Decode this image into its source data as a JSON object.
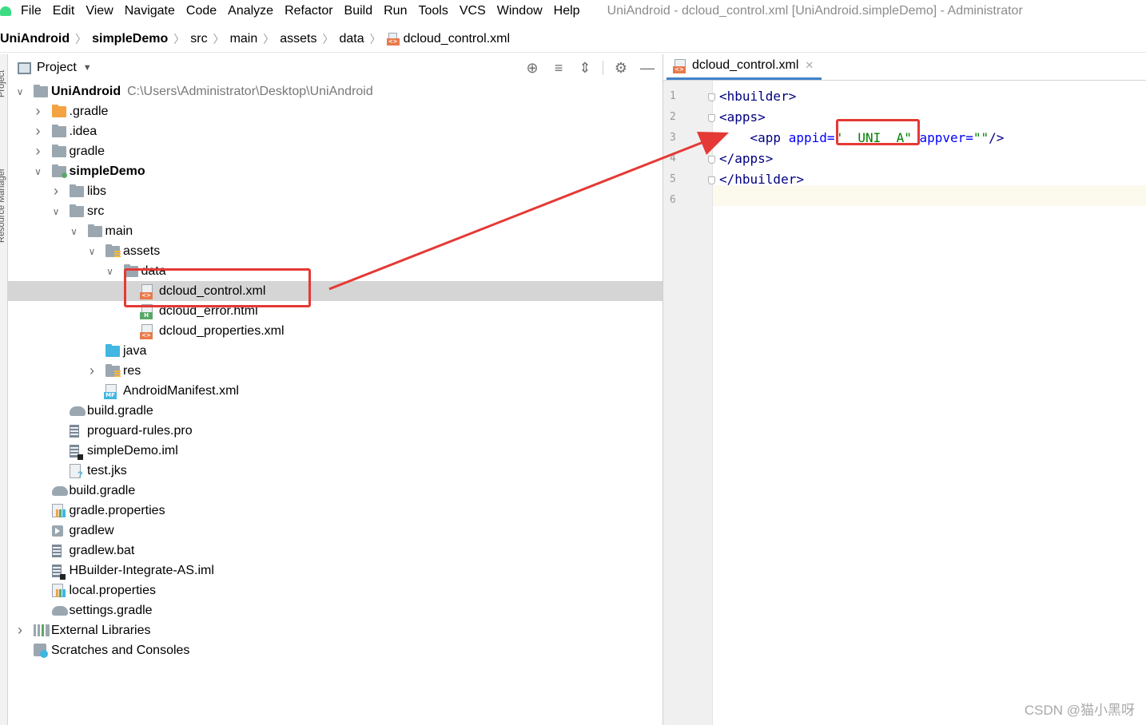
{
  "menu": {
    "items": [
      "File",
      "Edit",
      "View",
      "Navigate",
      "Code",
      "Analyze",
      "Refactor",
      "Build",
      "Run",
      "Tools",
      "VCS",
      "Window",
      "Help"
    ],
    "window_title": "UniAndroid - dcloud_control.xml [UniAndroid.simpleDemo] - Administrator"
  },
  "breadcrumb": {
    "project": "UniAndroid",
    "module": "simpleDemo",
    "parts": [
      "src",
      "main",
      "assets",
      "data"
    ],
    "file": "dcloud_control.xml"
  },
  "tool_strip": {
    "project_label": "Project",
    "resource_label": "Resource Manager"
  },
  "project_panel": {
    "title": "Project",
    "tools": [
      "locate-icon",
      "expand-all-icon",
      "collapse-all-icon",
      "gear-icon",
      "minimize-icon"
    ],
    "root": {
      "name": "UniAndroid",
      "path": "C:\\Users\\Administrator\\Desktop\\UniAndroid"
    },
    "tree": [
      {
        "label": ".gradle",
        "depth": 1,
        "chevron": "right",
        "icon": "folder-orange"
      },
      {
        "label": ".idea",
        "depth": 1,
        "chevron": "right",
        "icon": "folder"
      },
      {
        "label": "gradle",
        "depth": 1,
        "chevron": "right",
        "icon": "folder"
      },
      {
        "label": "simpleDemo",
        "depth": 1,
        "chevron": "down",
        "icon": "module-folder",
        "bold": true
      },
      {
        "label": "libs",
        "depth": 2,
        "chevron": "right",
        "icon": "folder"
      },
      {
        "label": "src",
        "depth": 2,
        "chevron": "down",
        "icon": "folder"
      },
      {
        "label": "main",
        "depth": 3,
        "chevron": "down",
        "icon": "folder"
      },
      {
        "label": "assets",
        "depth": 4,
        "chevron": "down",
        "icon": "resource-folder"
      },
      {
        "label": "data",
        "depth": 5,
        "chevron": "down",
        "icon": "folder"
      },
      {
        "label": "dcloud_control.xml",
        "depth": 6,
        "chevron": "",
        "icon": "xml-file",
        "selected": true
      },
      {
        "label": "dcloud_error.html",
        "depth": 6,
        "chevron": "",
        "icon": "html-file"
      },
      {
        "label": "dcloud_properties.xml",
        "depth": 6,
        "chevron": "",
        "icon": "xml-file"
      },
      {
        "label": "java",
        "depth": 4,
        "chevron": "",
        "icon": "folder-blue"
      },
      {
        "label": "res",
        "depth": 4,
        "chevron": "right",
        "icon": "resource-folder"
      },
      {
        "label": "AndroidManifest.xml",
        "depth": 4,
        "chevron": "",
        "icon": "manifest-file"
      },
      {
        "label": "build.gradle",
        "depth": 2,
        "chevron": "",
        "icon": "gradle-file"
      },
      {
        "label": "proguard-rules.pro",
        "depth": 2,
        "chevron": "",
        "icon": "text-file"
      },
      {
        "label": "simpleDemo.iml",
        "depth": 2,
        "chevron": "",
        "icon": "iml-file"
      },
      {
        "label": "test.jks",
        "depth": 2,
        "chevron": "",
        "icon": "unknown-file"
      },
      {
        "label": "build.gradle",
        "depth": 1,
        "chevron": "",
        "icon": "gradle-file"
      },
      {
        "label": "gradle.properties",
        "depth": 1,
        "chevron": "",
        "icon": "properties-file"
      },
      {
        "label": "gradlew",
        "depth": 1,
        "chevron": "",
        "icon": "exec-file"
      },
      {
        "label": "gradlew.bat",
        "depth": 1,
        "chevron": "",
        "icon": "text-file"
      },
      {
        "label": "HBuilder-Integrate-AS.iml",
        "depth": 1,
        "chevron": "",
        "icon": "iml-file"
      },
      {
        "label": "local.properties",
        "depth": 1,
        "chevron": "",
        "icon": "properties-file"
      },
      {
        "label": "settings.gradle",
        "depth": 1,
        "chevron": "",
        "icon": "gradle-file"
      },
      {
        "label": "External Libraries",
        "depth": 0,
        "chevron": "right",
        "icon": "libraries"
      },
      {
        "label": "Scratches and Consoles",
        "depth": 0,
        "chevron": "",
        "icon": "scratches"
      }
    ]
  },
  "editor": {
    "tab_label": "dcloud_control.xml",
    "line_numbers": [
      "1",
      "2",
      "3",
      "4",
      "5",
      "6"
    ],
    "lines": [
      [
        {
          "t": "<hbuilder>",
          "c": "tag"
        }
      ],
      [
        {
          "t": "<apps>",
          "c": "tag"
        }
      ],
      [
        {
          "t": "    <app ",
          "c": "tag"
        },
        {
          "t": "appid=",
          "c": "attr"
        },
        {
          "t": "\"__UNI__A\"",
          "c": "val"
        },
        {
          "t": " appver=",
          "c": "attr"
        },
        {
          "t": "\"\"",
          "c": "val"
        },
        {
          "t": "/>",
          "c": "tag"
        }
      ],
      [
        {
          "t": "</apps>",
          "c": "tag"
        }
      ],
      [
        {
          "t": "</hbuilder>",
          "c": "tag"
        }
      ],
      []
    ]
  },
  "colors": {
    "annotation_red": "#e53935",
    "selection": "#d5d5d5",
    "xml_tag": "#000080",
    "xml_attr": "#0000ff",
    "xml_value": "#008000"
  },
  "watermark": "CSDN @猫小黑呀"
}
